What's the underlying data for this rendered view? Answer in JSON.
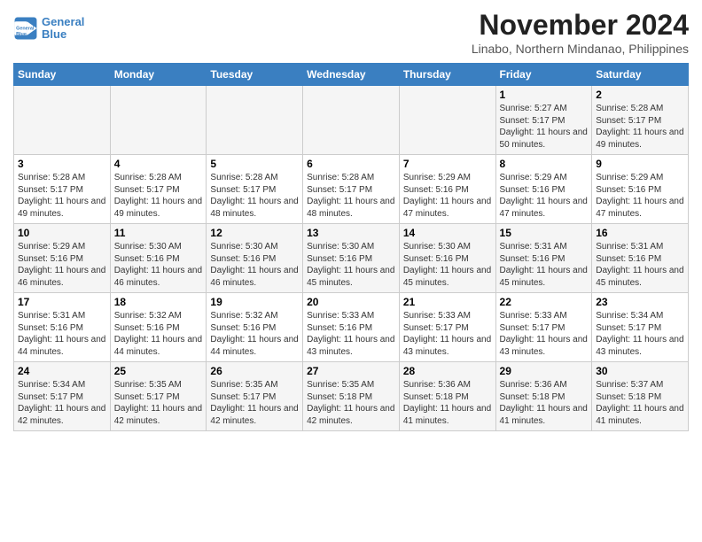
{
  "header": {
    "logo_line1": "General",
    "logo_line2": "Blue",
    "month": "November 2024",
    "location": "Linabo, Northern Mindanao, Philippines"
  },
  "weekdays": [
    "Sunday",
    "Monday",
    "Tuesday",
    "Wednesday",
    "Thursday",
    "Friday",
    "Saturday"
  ],
  "weeks": [
    [
      {
        "day": "",
        "info": ""
      },
      {
        "day": "",
        "info": ""
      },
      {
        "day": "",
        "info": ""
      },
      {
        "day": "",
        "info": ""
      },
      {
        "day": "",
        "info": ""
      },
      {
        "day": "1",
        "info": "Sunrise: 5:27 AM\nSunset: 5:17 PM\nDaylight: 11 hours and 50 minutes."
      },
      {
        "day": "2",
        "info": "Sunrise: 5:28 AM\nSunset: 5:17 PM\nDaylight: 11 hours and 49 minutes."
      }
    ],
    [
      {
        "day": "3",
        "info": "Sunrise: 5:28 AM\nSunset: 5:17 PM\nDaylight: 11 hours and 49 minutes."
      },
      {
        "day": "4",
        "info": "Sunrise: 5:28 AM\nSunset: 5:17 PM\nDaylight: 11 hours and 49 minutes."
      },
      {
        "day": "5",
        "info": "Sunrise: 5:28 AM\nSunset: 5:17 PM\nDaylight: 11 hours and 48 minutes."
      },
      {
        "day": "6",
        "info": "Sunrise: 5:28 AM\nSunset: 5:17 PM\nDaylight: 11 hours and 48 minutes."
      },
      {
        "day": "7",
        "info": "Sunrise: 5:29 AM\nSunset: 5:16 PM\nDaylight: 11 hours and 47 minutes."
      },
      {
        "day": "8",
        "info": "Sunrise: 5:29 AM\nSunset: 5:16 PM\nDaylight: 11 hours and 47 minutes."
      },
      {
        "day": "9",
        "info": "Sunrise: 5:29 AM\nSunset: 5:16 PM\nDaylight: 11 hours and 47 minutes."
      }
    ],
    [
      {
        "day": "10",
        "info": "Sunrise: 5:29 AM\nSunset: 5:16 PM\nDaylight: 11 hours and 46 minutes."
      },
      {
        "day": "11",
        "info": "Sunrise: 5:30 AM\nSunset: 5:16 PM\nDaylight: 11 hours and 46 minutes."
      },
      {
        "day": "12",
        "info": "Sunrise: 5:30 AM\nSunset: 5:16 PM\nDaylight: 11 hours and 46 minutes."
      },
      {
        "day": "13",
        "info": "Sunrise: 5:30 AM\nSunset: 5:16 PM\nDaylight: 11 hours and 45 minutes."
      },
      {
        "day": "14",
        "info": "Sunrise: 5:30 AM\nSunset: 5:16 PM\nDaylight: 11 hours and 45 minutes."
      },
      {
        "day": "15",
        "info": "Sunrise: 5:31 AM\nSunset: 5:16 PM\nDaylight: 11 hours and 45 minutes."
      },
      {
        "day": "16",
        "info": "Sunrise: 5:31 AM\nSunset: 5:16 PM\nDaylight: 11 hours and 45 minutes."
      }
    ],
    [
      {
        "day": "17",
        "info": "Sunrise: 5:31 AM\nSunset: 5:16 PM\nDaylight: 11 hours and 44 minutes."
      },
      {
        "day": "18",
        "info": "Sunrise: 5:32 AM\nSunset: 5:16 PM\nDaylight: 11 hours and 44 minutes."
      },
      {
        "day": "19",
        "info": "Sunrise: 5:32 AM\nSunset: 5:16 PM\nDaylight: 11 hours and 44 minutes."
      },
      {
        "day": "20",
        "info": "Sunrise: 5:33 AM\nSunset: 5:16 PM\nDaylight: 11 hours and 43 minutes."
      },
      {
        "day": "21",
        "info": "Sunrise: 5:33 AM\nSunset: 5:17 PM\nDaylight: 11 hours and 43 minutes."
      },
      {
        "day": "22",
        "info": "Sunrise: 5:33 AM\nSunset: 5:17 PM\nDaylight: 11 hours and 43 minutes."
      },
      {
        "day": "23",
        "info": "Sunrise: 5:34 AM\nSunset: 5:17 PM\nDaylight: 11 hours and 43 minutes."
      }
    ],
    [
      {
        "day": "24",
        "info": "Sunrise: 5:34 AM\nSunset: 5:17 PM\nDaylight: 11 hours and 42 minutes."
      },
      {
        "day": "25",
        "info": "Sunrise: 5:35 AM\nSunset: 5:17 PM\nDaylight: 11 hours and 42 minutes."
      },
      {
        "day": "26",
        "info": "Sunrise: 5:35 AM\nSunset: 5:17 PM\nDaylight: 11 hours and 42 minutes."
      },
      {
        "day": "27",
        "info": "Sunrise: 5:35 AM\nSunset: 5:18 PM\nDaylight: 11 hours and 42 minutes."
      },
      {
        "day": "28",
        "info": "Sunrise: 5:36 AM\nSunset: 5:18 PM\nDaylight: 11 hours and 41 minutes."
      },
      {
        "day": "29",
        "info": "Sunrise: 5:36 AM\nSunset: 5:18 PM\nDaylight: 11 hours and 41 minutes."
      },
      {
        "day": "30",
        "info": "Sunrise: 5:37 AM\nSunset: 5:18 PM\nDaylight: 11 hours and 41 minutes."
      }
    ]
  ]
}
